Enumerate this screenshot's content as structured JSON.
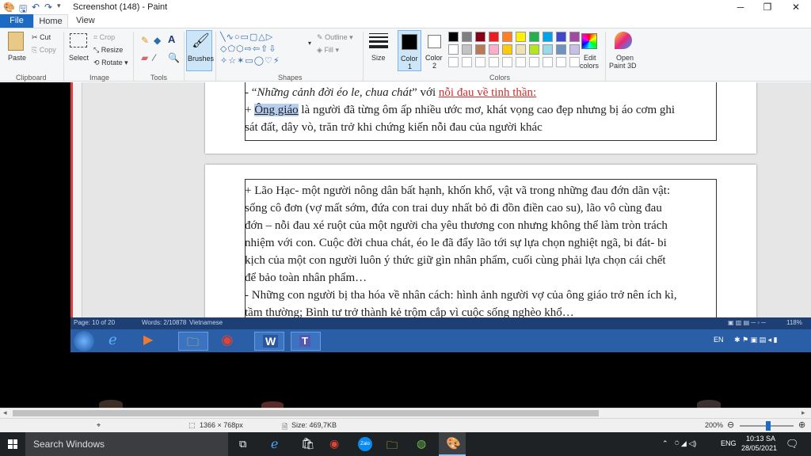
{
  "window": {
    "title": "Screenshot (148) - Paint",
    "minimize": "─",
    "maximize": "❐",
    "close": "✕"
  },
  "tabs": {
    "file": "File",
    "home": "Home",
    "view": "View"
  },
  "ribbon": {
    "clipboard": {
      "paste": "Paste",
      "cut": "Cut",
      "copy": "Copy",
      "label": "Clipboard"
    },
    "image": {
      "select": "Select",
      "crop": "Crop",
      "resize": "Resize",
      "rotate": "Rotate",
      "label": "Image"
    },
    "tools": {
      "label": "Tools"
    },
    "brushes": "Brushes",
    "shapes": {
      "outline": "Outline",
      "fill": "Fill",
      "label": "Shapes"
    },
    "size": "Size",
    "color1": {
      "line1": "Color",
      "line2": "1"
    },
    "color2": {
      "line1": "Color",
      "line2": "2"
    },
    "colors_label": "Colors",
    "edit_colors": {
      "line1": "Edit",
      "line2": "colors"
    },
    "open_paint3d": {
      "line1": "Open",
      "line2": "Paint 3D"
    },
    "palette": [
      "#000000",
      "#7f7f7f",
      "#880015",
      "#ed1c24",
      "#ff7f27",
      "#fff200",
      "#22b14c",
      "#00a2e8",
      "#3f48cc",
      "#a349a4",
      "#ffffff",
      "#c3c3c3",
      "#b97a57",
      "#ffaec9",
      "#ffc90e",
      "#efe4b0",
      "#b5e61d",
      "#99d9ea",
      "#7092be",
      "#c8bfe7"
    ]
  },
  "doc": {
    "page1": {
      "l1_a": "- “",
      "l1_b": "Những cảnh đời éo le, chua chát",
      "l1_c": "” với ",
      "l1_d": "nỗi đau về tinh thần:",
      "l2_a": "+ ",
      "l2_b": "Ông giáo",
      "l2_c": " là người đã từng ôm ấp nhiều ước mơ, khát vọng cao đẹp nhưng bị áo cơm ghi",
      "l3": "sát đất, dây vò, trăn trở khi chứng kiến nỗi đau của người khác"
    },
    "page2": [
      "+ Lão Hạc- một người nông dân bất hạnh, khốn khổ, vật vã trong những đau đớn dãn vật:",
      "sống cô đơn (vợ mất sớm, đứa con trai duy nhất bỏ đi đồn điền cao su), lão vô cùng đau",
      "đớn – nỗi đau xé ruột của một người cha yêu thương con nhưng không thể làm tròn trách",
      "nhiệm với con. Cuộc đời chua chát, éo le đã đẩy lão tới sự lựa chọn nghiệt ngã, bi đát- bi",
      "kịch của một con người luôn ý thức giữ gìn nhân phẩm, cuối cùng phải lựa chọn cái chết",
      "để bảo toàn nhân phẩm…",
      "- Những con người bị tha hóa về nhân cách: hình ảnh người vợ của ông giáo trở nên ích kì,",
      "tầm thường; Bình tư trở thành kẻ trộm cắp vì cuộc sống nghèo khổ…"
    ]
  },
  "word_status": {
    "page": "Page: 10 of 20",
    "words": "Words: 2/10878",
    "lang": "Vietnamese",
    "zoom": "118%"
  },
  "inner_tray": {
    "lang": "EN"
  },
  "statusbar": {
    "dimensions": "1366 × 768px",
    "size": "Size: 469,7KB",
    "zoom": "200%"
  },
  "taskbar": {
    "search": "Search Windows",
    "lang": "ENG",
    "time": "10:13 SA",
    "date": "28/05/2021"
  },
  "colors": {
    "accent": "#1c6ac4",
    "ribbon_bg": "#f5f6f7",
    "taskbar": "#1f2225"
  }
}
